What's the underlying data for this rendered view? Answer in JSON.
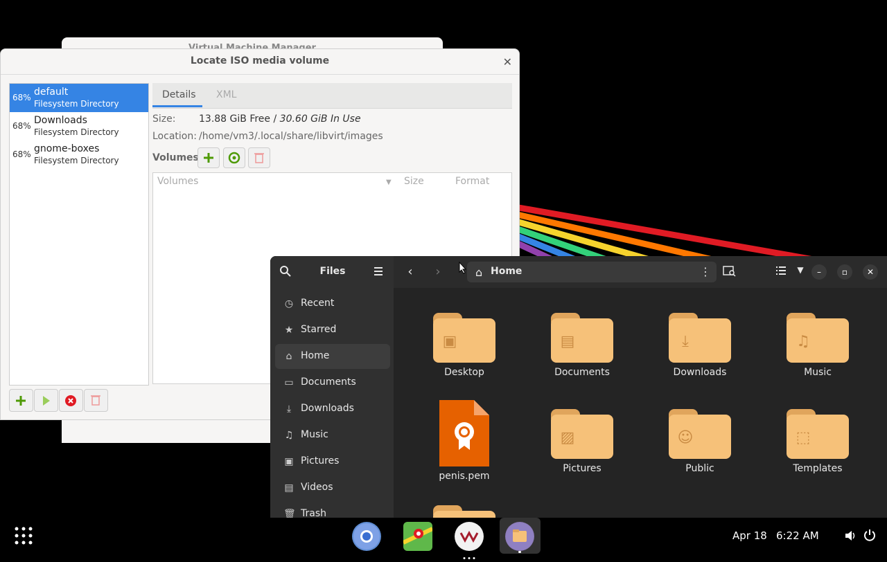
{
  "vmm_window": {
    "title": "Virtual Machine Manager"
  },
  "dialog": {
    "title": "Locate ISO media volume",
    "pools": [
      {
        "percent": "68%",
        "name": "default",
        "type": "Filesystem Directory"
      },
      {
        "percent": "68%",
        "name": "Downloads",
        "type": "Filesystem Directory"
      },
      {
        "percent": "68%",
        "name": "gnome-boxes",
        "type": "Filesystem Directory"
      }
    ],
    "tabs": {
      "details": "Details",
      "xml": "XML"
    },
    "size_label": "Size:",
    "size_free": "13.88 GiB Free / ",
    "size_in_use": "30.60 GiB In Use",
    "location_label": "Location:",
    "location_value": "/home/vm3/.local/share/libvirt/images",
    "volumes_label": "Volumes",
    "columns": {
      "volumes": "Volumes",
      "size": "Size",
      "format": "Format"
    }
  },
  "files": {
    "title": "Files",
    "path": "Home",
    "sidebar": [
      {
        "label": "Recent",
        "icon": "clock-icon"
      },
      {
        "label": "Starred",
        "icon": "star-icon"
      },
      {
        "label": "Home",
        "icon": "home-icon"
      },
      {
        "label": "Documents",
        "icon": "document-icon"
      },
      {
        "label": "Downloads",
        "icon": "download-icon"
      },
      {
        "label": "Music",
        "icon": "music-icon"
      },
      {
        "label": "Pictures",
        "icon": "picture-icon"
      },
      {
        "label": "Videos",
        "icon": "video-icon"
      },
      {
        "label": "Trash",
        "icon": "trash-icon"
      }
    ],
    "items": [
      {
        "label": "Desktop",
        "icon": "desktop-folder-icon"
      },
      {
        "label": "Documents",
        "icon": "documents-folder-icon"
      },
      {
        "label": "Downloads",
        "icon": "downloads-folder-icon"
      },
      {
        "label": "Music",
        "icon": "music-folder-icon"
      },
      {
        "label": "penis.pem",
        "icon": "certificate-file-icon"
      },
      {
        "label": "Pictures",
        "icon": "pictures-folder-icon"
      },
      {
        "label": "Public",
        "icon": "public-folder-icon"
      },
      {
        "label": "Templates",
        "icon": "templates-folder-icon"
      }
    ]
  },
  "taskbar": {
    "date": "Apr 18",
    "time": "6:22 AM"
  },
  "colors": {
    "accent": "#3584e4",
    "folder": "#f6c179",
    "pem": "#e66100"
  }
}
